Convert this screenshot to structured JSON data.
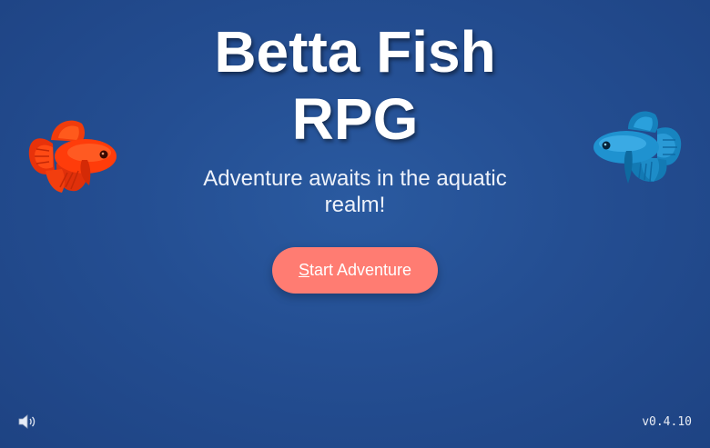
{
  "title": {
    "line1": "Betta Fish",
    "line2": "RPG"
  },
  "subtitle": "Adventure awaits in the aquatic realm!",
  "start_button": {
    "label_first_letter": "S",
    "label_rest": "tart Adventure"
  },
  "version": "v0.4.10",
  "icons": {
    "sound": "speaker-icon",
    "left_fish": "red-betta-fish-icon",
    "right_fish": "blue-betta-fish-icon"
  },
  "colors": {
    "background": "#244e92",
    "button": "#ff7c72",
    "red_fish": "#ff3b0a",
    "blue_fish": "#1a8ec8"
  }
}
